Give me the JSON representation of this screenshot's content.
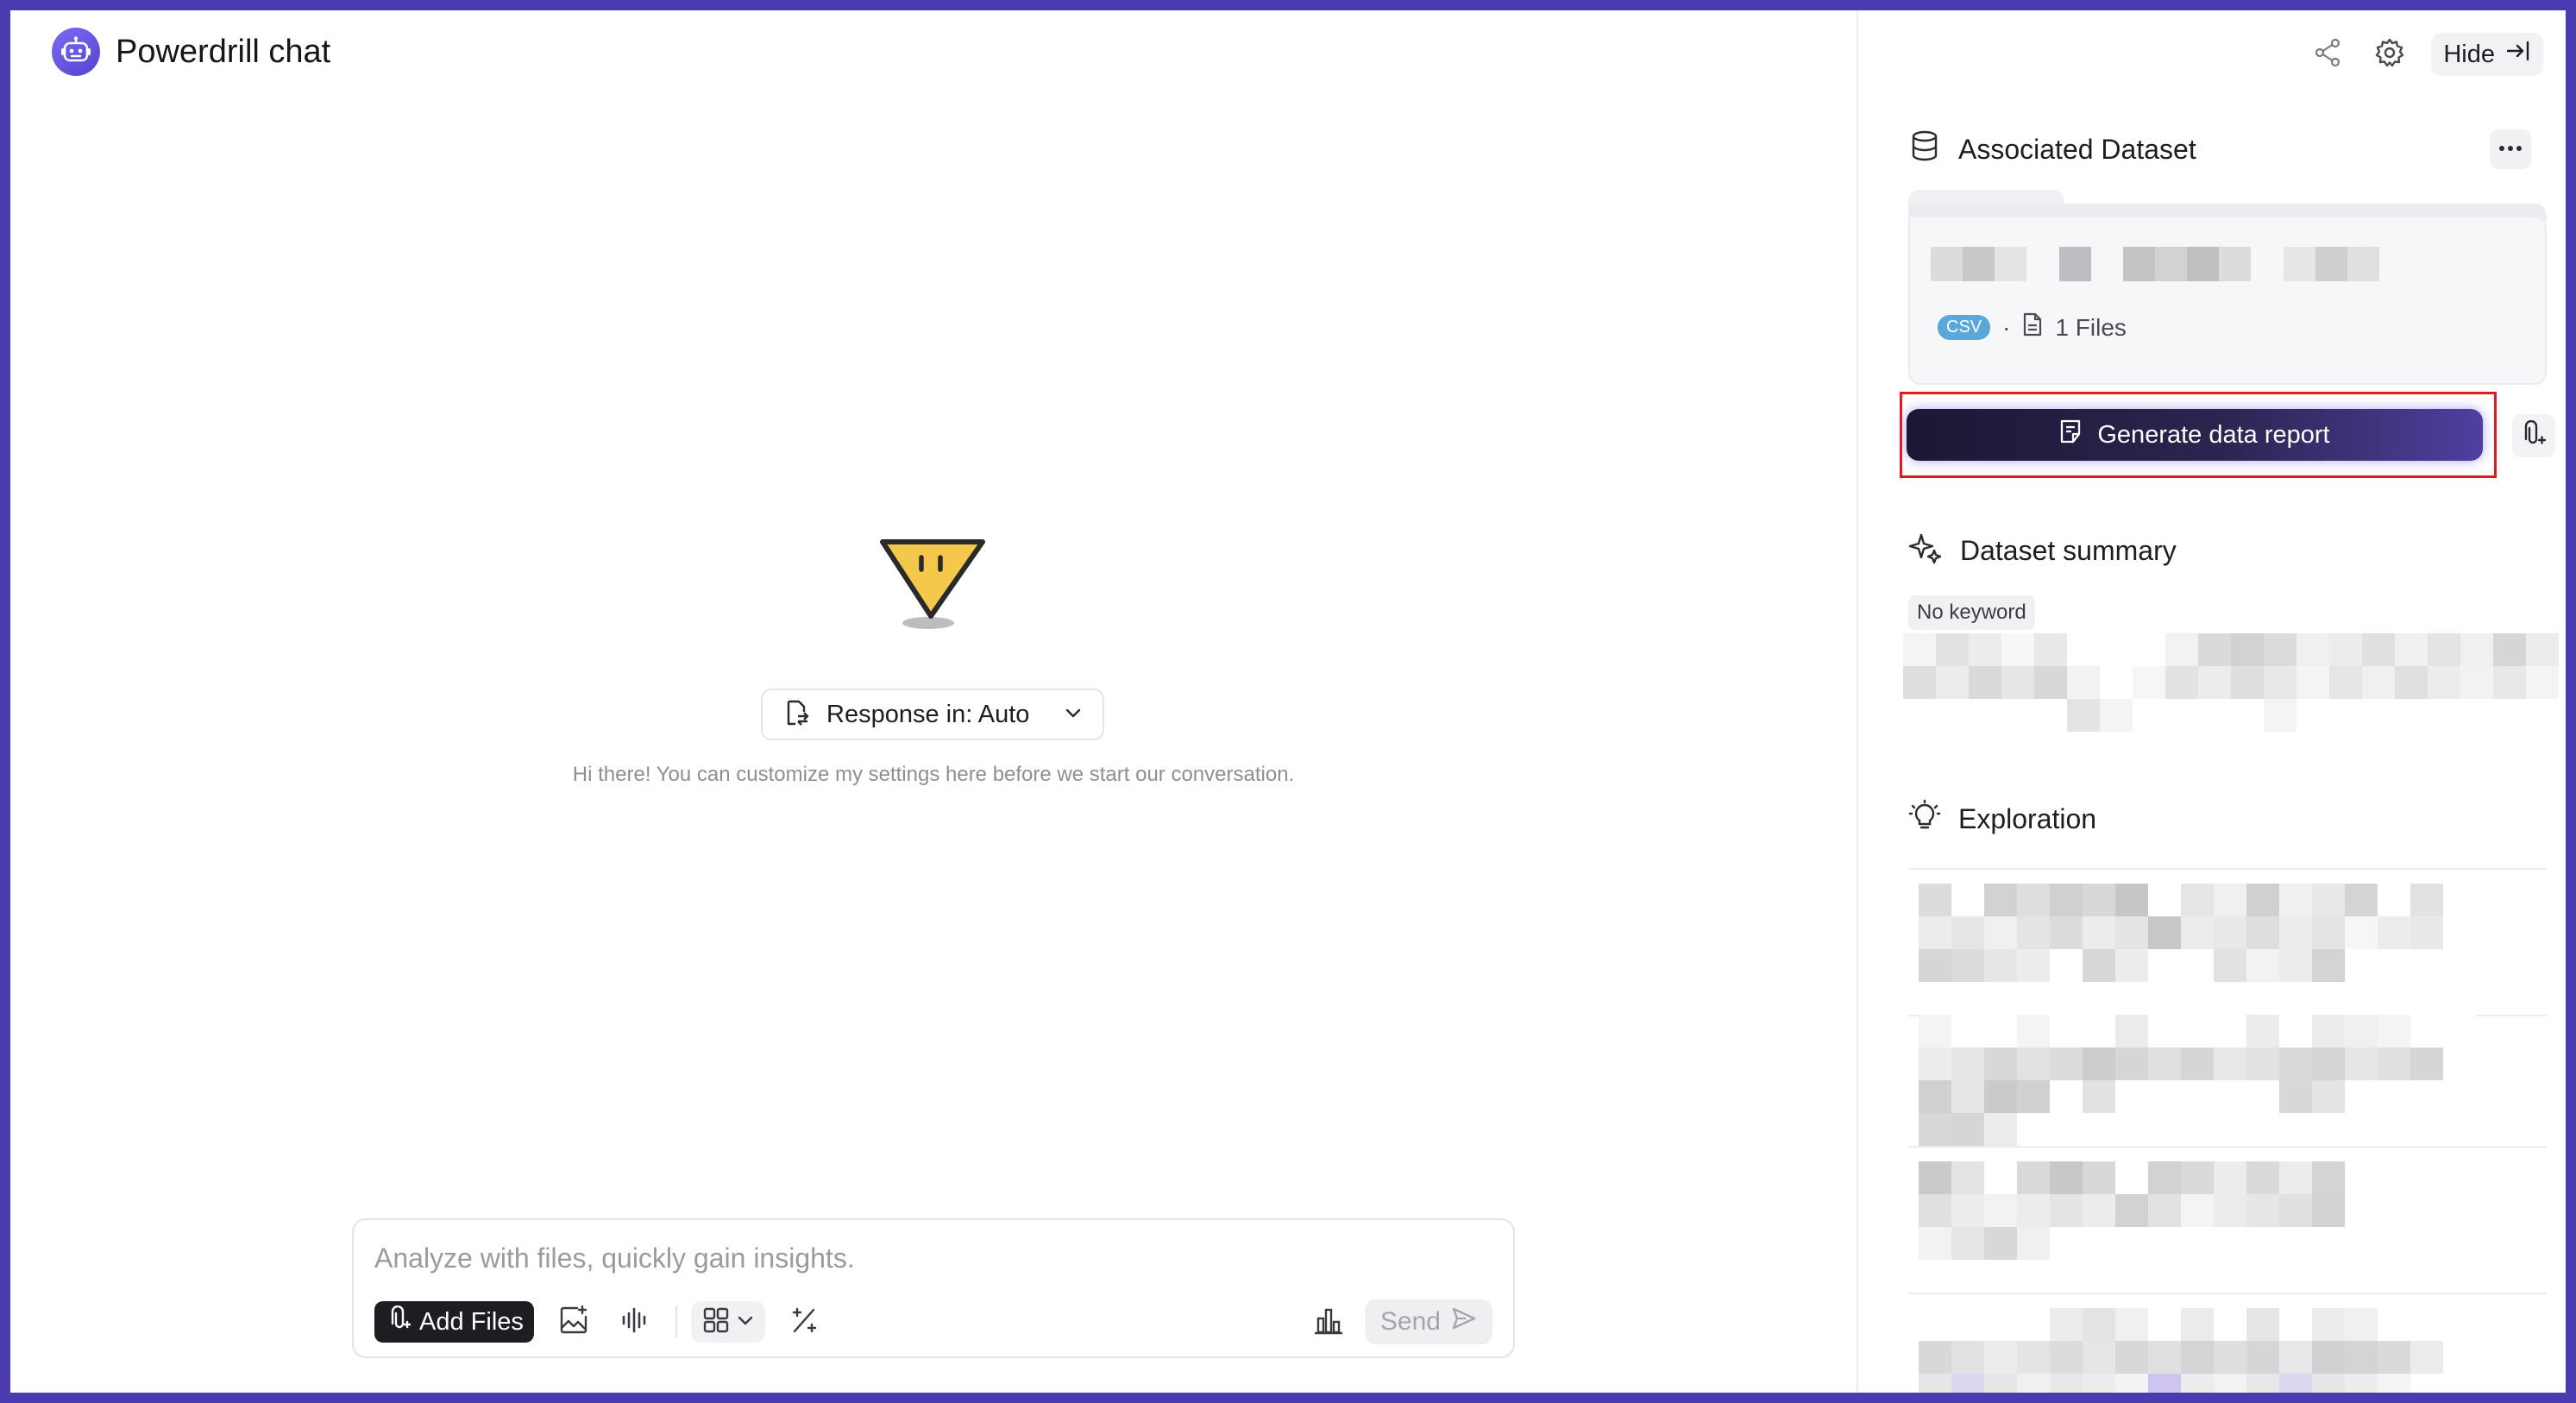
{
  "app": {
    "title": "Powerdrill chat"
  },
  "main": {
    "response_select": {
      "label": "Response in: Auto"
    },
    "hint": "Hi there! You can customize my settings here before we start our conversation."
  },
  "composer": {
    "placeholder": "Analyze with files, quickly gain insights.",
    "add_files_label": "Add Files",
    "send_label": "Send"
  },
  "panel": {
    "hide_label": "Hide",
    "associated_dataset_title": "Associated Dataset",
    "dataset": {
      "badge": "CSV",
      "separator": "·",
      "file_count": "1 Files"
    },
    "generate_label": "Generate data report",
    "summary_title": "Dataset summary",
    "keyword_chip": "No keyword",
    "exploration_title": "Exploration"
  },
  "colors": {
    "frame_border": "#4a3bb0",
    "accent": "#6b5ce7",
    "highlight_box": "#e11b22",
    "csv_badge": "#5aa7d9"
  },
  "icons": {
    "brand": "robot-icon",
    "share": "share-icon",
    "settings": "gear-icon",
    "hide": "collapse-right-icon",
    "dataset": "database-icon",
    "summary": "sparkles-icon",
    "exploration": "lightbulb-icon"
  }
}
